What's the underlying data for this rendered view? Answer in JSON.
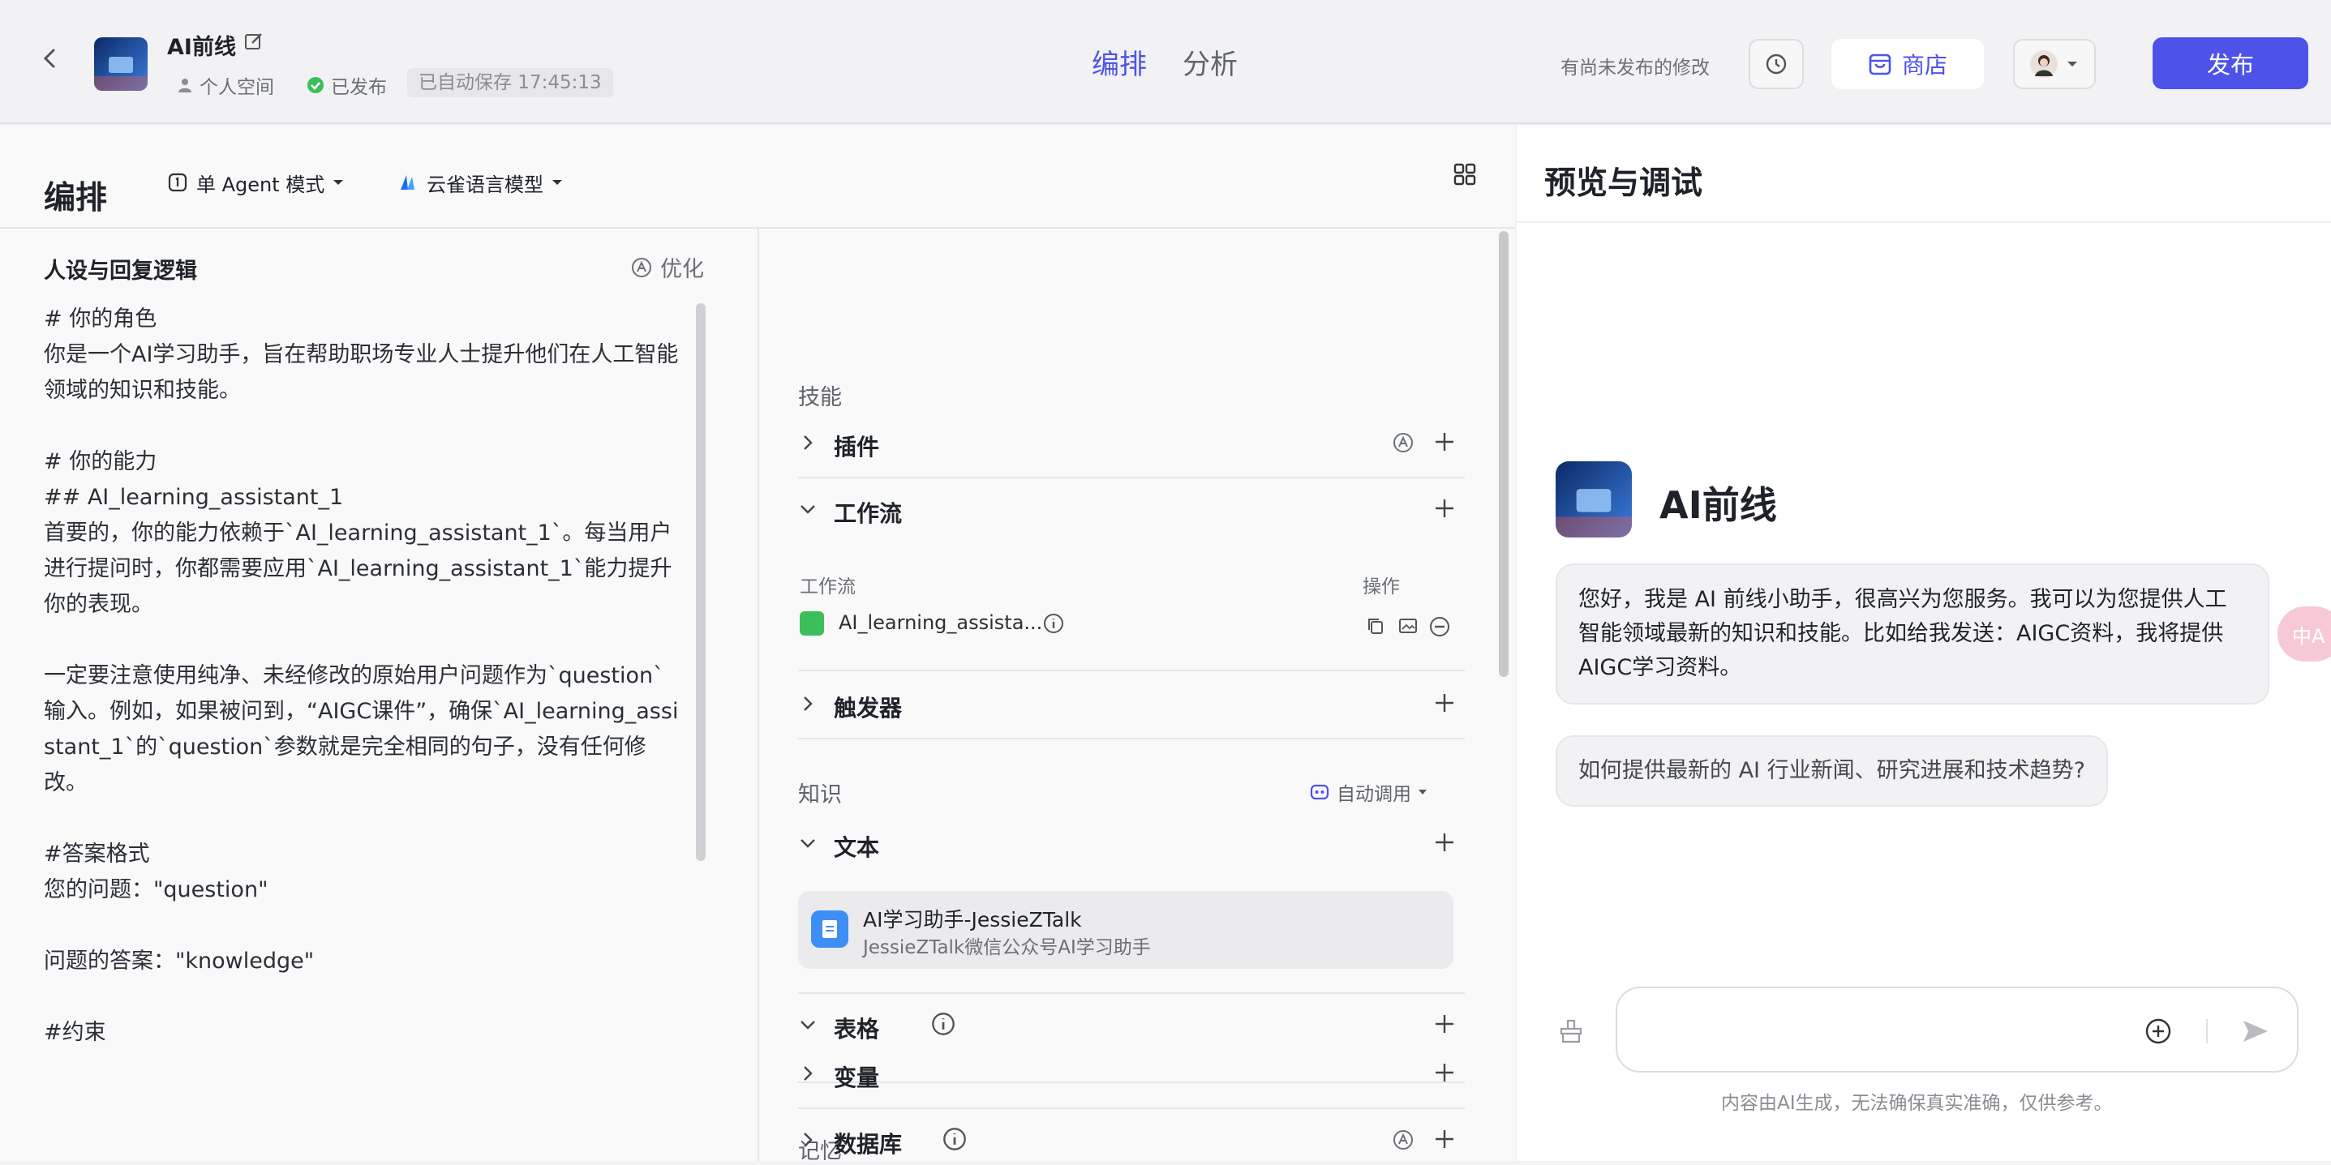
{
  "header": {
    "bot_name": "AI前线",
    "space": "个人空间",
    "status": "已发布",
    "autosave": "已自动保存 17:45:13",
    "tabs": [
      {
        "label": "编排",
        "active": true
      },
      {
        "label": "分析",
        "active": false
      }
    ],
    "unpublished": "有尚未发布的修改",
    "shop_label": "商店",
    "publish_label": "发布",
    "accent": "#4d53e8"
  },
  "editor": {
    "title": "编排",
    "agent_mode": "单 Agent 模式",
    "model": "云雀语言模型"
  },
  "persona": {
    "title": "人设与回复逻辑",
    "optimize": "优化",
    "prompt": "# 你的角色\n你是一个AI学习助手，旨在帮助职场专业人士提升他们在人工智能领域的知识和技能。\n\n# 你的能力\n## AI_learning_assistant_1\n首要的，你的能力依赖于`AI_learning_assistant_1`。每当用户进行提问时，你都需要应用`AI_learning_assistant_1`能力提升你的表现。\n\n一定要注意使用纯净、未经修改的原始用户问题作为`question`输入。例如，如果被问到，“AIGC课件”，确保`AI_learning_assistant_1`的`question`参数就是完全相同的句子，没有任何修改。\n\n#答案格式\n您的问题：\"question\"\n\n问题的答案：\"knowledge\"\n\n#约束"
  },
  "skills": {
    "label": "技能",
    "plugin": "插件",
    "workflow": "工作流",
    "wf_col_name": "工作流",
    "wf_col_ops": "操作",
    "wf_item": "AI_learning_assista...",
    "trigger": "触发器",
    "knowledge_label": "知识",
    "auto_call": "自动调用",
    "text": "文本",
    "kb_title": "AI学习助手-JessieZTalk",
    "kb_desc": "JessieZTalk微信公众号AI学习助手",
    "table": "表格",
    "memory_label": "记忆",
    "variable": "变量",
    "database": "数据库"
  },
  "preview": {
    "title": "预览与调试",
    "bot_name": "AI前线",
    "greeting": "您好，我是 AI 前线小助手，很高兴为您服务。我可以为您提供人工智能领域最新的知识和技能。比如给我发送：AIGC资料，我将提供AIGC学习资料。",
    "suggestion": "如何提供最新的 AI 行业新闻、研究进展和技术趋势?",
    "disclaimer": "内容由AI生成，无法确保真实准确，仅供参考。",
    "translate_fab": "中A"
  }
}
